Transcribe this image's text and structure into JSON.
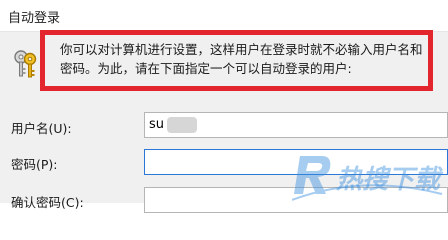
{
  "window": {
    "title": "自动登录"
  },
  "description": {
    "text": "你可以对计算机进行设置，这样用户在登录时就不必输入用户名和密码。为此，请在下面指定一个可以自动登录的用户:"
  },
  "fields": {
    "username": {
      "label": "用户名(U):",
      "value": "su"
    },
    "password": {
      "label": "密码(P):",
      "value": ""
    },
    "confirm": {
      "label": "确认密码(C):",
      "value": ""
    }
  },
  "watermark": {
    "text": "热搜下载"
  },
  "colors": {
    "highlight": "#e3262e",
    "focus_border": "#2b78d6",
    "panel_bg": "#f0f0f0",
    "watermark": "#3b8fe0"
  }
}
